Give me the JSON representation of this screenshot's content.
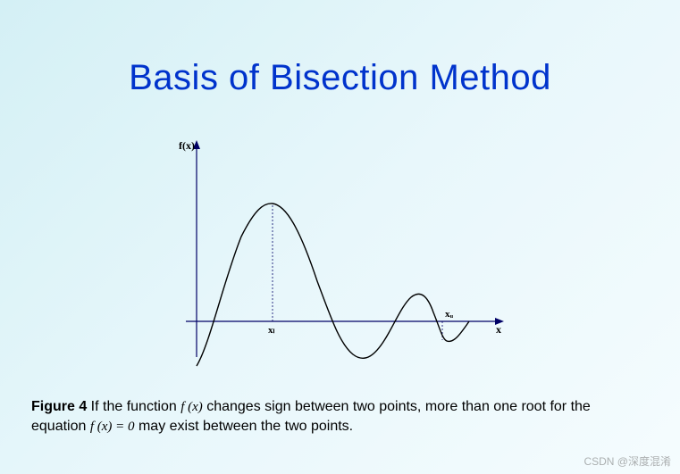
{
  "title": "Basis of Bisection Method",
  "axis_label_y": "f(x)",
  "axis_label_x": "x",
  "point_label_xl": "xₗ",
  "point_label_xu": "xᵤ",
  "caption": {
    "figure_label": "Figure 4",
    "text_part1": " If the function  ",
    "math_fx": "f (x)",
    "text_part2": "  changes sign between two points, more than one root for the equation  ",
    "math_eq": "f (x) = 0",
    "text_part3": "   may exist between the two points."
  },
  "watermark": "CSDN @深度混淆",
  "chart_data": {
    "type": "line",
    "title": "",
    "xlabel": "x",
    "ylabel": "f(x)",
    "x": [
      0,
      0.5,
      1.0,
      1.5,
      1.8,
      2.0,
      2.5,
      3.0,
      3.3,
      3.6,
      4.0,
      4.3,
      4.5,
      4.7,
      5.0,
      5.2,
      5.4,
      5.6
    ],
    "y": [
      -1.2,
      0.2,
      1.2,
      1.55,
      1.5,
      1.3,
      0.4,
      -0.5,
      -0.75,
      -0.6,
      0,
      0.35,
      0.45,
      0.35,
      -0.1,
      -0.35,
      -0.2,
      0
    ],
    "xlim": [
      -0.3,
      6.2
    ],
    "ylim": [
      -1.5,
      2.0
    ],
    "annotations": [
      {
        "label": "xₗ",
        "x": 1.8,
        "y": 0
      },
      {
        "label": "xᵤ",
        "x": 5.2,
        "y": 0
      }
    ]
  }
}
